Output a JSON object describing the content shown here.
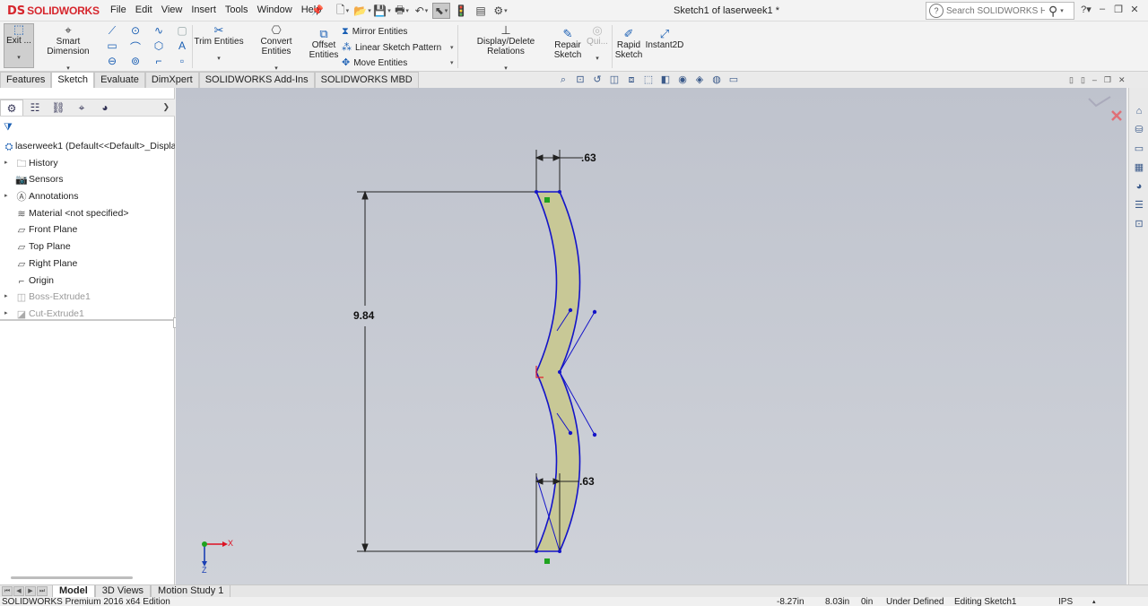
{
  "app": {
    "name": "SOLIDWORKS",
    "document_title": "Sketch1 of laserweek1 *"
  },
  "menu": {
    "items": [
      "File",
      "Edit",
      "View",
      "Insert",
      "Tools",
      "Window",
      "Help"
    ]
  },
  "help_search": {
    "placeholder": "Search SOLIDWORKS Help"
  },
  "ribbon": {
    "exit_sketch": "Exit ...",
    "smart_dimension": "Smart Dimension",
    "trim_entities": "Trim Entities",
    "convert_entities": "Convert Entities",
    "offset_entities_1": "Offset",
    "offset_entities_2": "Entities",
    "mirror_entities": "Mirror Entities",
    "linear_sketch_pattern": "Linear Sketch Pattern",
    "move_entities": "Move Entities",
    "display_delete_relations": "Display/Delete Relations",
    "repair_sketch_1": "Repair",
    "repair_sketch_2": "Sketch",
    "quick_snaps": "Qui...",
    "rapid_sketch_1": "Rapid",
    "rapid_sketch_2": "Sketch",
    "instant2d": "Instant2D"
  },
  "command_tabs": [
    "Features",
    "Sketch",
    "Evaluate",
    "DimXpert",
    "SOLIDWORKS Add-Ins",
    "SOLIDWORKS MBD"
  ],
  "active_command_tab": "Sketch",
  "feature_tree": {
    "root": "laserweek1  (Default<<Default>_Displa",
    "items": [
      {
        "label": "History",
        "icon": "history-folder-icon",
        "expandable": true,
        "dim": false
      },
      {
        "label": "Sensors",
        "icon": "sensors-icon",
        "expandable": false,
        "dim": false
      },
      {
        "label": "Annotations",
        "icon": "annotations-icon",
        "expandable": true,
        "dim": false
      },
      {
        "label": "Material <not specified>",
        "icon": "material-icon",
        "expandable": false,
        "dim": false
      },
      {
        "label": "Front Plane",
        "icon": "plane-icon",
        "expandable": false,
        "dim": false
      },
      {
        "label": "Top Plane",
        "icon": "plane-icon",
        "expandable": false,
        "dim": false
      },
      {
        "label": "Right Plane",
        "icon": "plane-icon",
        "expandable": false,
        "dim": false
      },
      {
        "label": "Origin",
        "icon": "origin-icon",
        "expandable": false,
        "dim": false
      },
      {
        "label": "Boss-Extrude1",
        "icon": "boss-extrude-icon",
        "expandable": true,
        "dim": true
      },
      {
        "label": "Cut-Extrude1",
        "icon": "cut-extrude-icon",
        "expandable": true,
        "dim": true
      }
    ]
  },
  "sketch": {
    "dim_top": ".63",
    "dim_height": "9.84",
    "dim_bottom": ".63",
    "triad_x": "X",
    "triad_z": "Z",
    "profile_fill": "#c8c896",
    "line_color": "#1414c8"
  },
  "bottom_tabs": [
    "Model",
    "3D Views",
    "Motion Study 1"
  ],
  "active_bottom_tab": "Model",
  "status": {
    "edition": "SOLIDWORKS Premium 2016 x64 Edition",
    "x": "-8.27in",
    "y": "8.03in",
    "z": "0in",
    "definition": "Under Defined",
    "mode": "Editing Sketch1",
    "units": "IPS"
  }
}
